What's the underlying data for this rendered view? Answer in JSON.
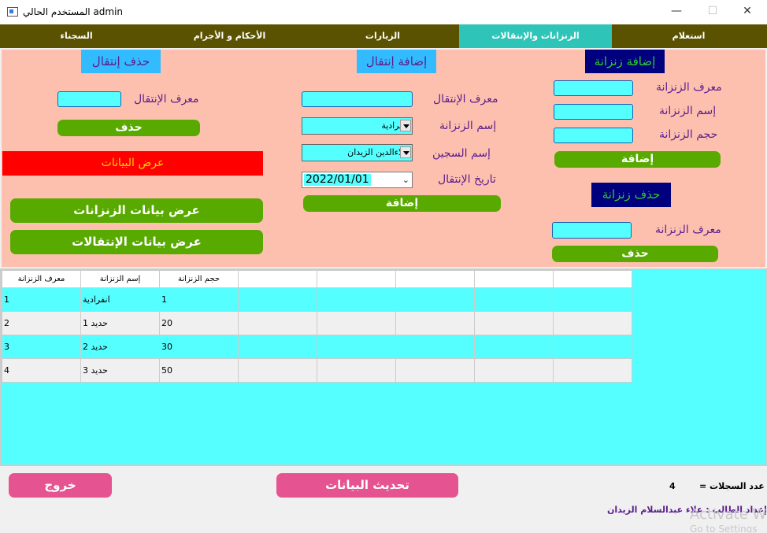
{
  "window": {
    "title": "المستخدم الحالي admin",
    "minimize": "—",
    "maximize": "☐",
    "close": "✕"
  },
  "tabs": {
    "t1": "استعلام",
    "t2": "الزنزانات والإنتقالات",
    "t3": "الزيارات",
    "t4": "الأحكام و الأجرام",
    "t5": "السجناء"
  },
  "cells_section": {
    "add_header": "إضافة زنزانة",
    "cell_id_label": "معرف الزنزانة",
    "cell_name_label": "إسم الزنزانة",
    "cell_size_label": "حجم الزنزانة",
    "add_button": "إضافة",
    "delete_header": "حذف زنزانة",
    "delete_id_label": "معرف الزنزانة",
    "delete_button": "حذف"
  },
  "transfer_section": {
    "add_header": "إضافة إنتقال",
    "transfer_id_label": "معرف الإنتقال",
    "cell_name_label": "إسم الزنزانة",
    "cell_name_selected": "انفرادية",
    "prisoner_name_label": "إسم السجين",
    "prisoner_name_selected": "علاءالدين الزيدان",
    "transfer_date_label": "تاريخ الإنتقال",
    "transfer_date_value": "2022/01/01",
    "add_button": "إضافة"
  },
  "delete_transfer_section": {
    "header": "حذف إنتقال",
    "transfer_id_label": "معرف الإنتقال",
    "delete_button": "حذف",
    "show_data_label": "عرض البيانات",
    "show_cells_button": "عرض بيانات الزنزانات",
    "show_transfers_button": "عرض بيانات الإنتقالات"
  },
  "grid": {
    "headers": [
      "معرف الزنزانة",
      "إسم الزنزانة",
      "حجم الزنزانة",
      "",
      "",
      "",
      "",
      ""
    ],
    "rows": [
      {
        "c1": "1",
        "c2": "انفرادية",
        "c3": "1"
      },
      {
        "c1": "2",
        "c2": "حديد 1",
        "c3": "20"
      },
      {
        "c1": "3",
        "c2": "حديد 2",
        "c3": "30"
      },
      {
        "c1": "4",
        "c2": "حديد 3",
        "c3": "50"
      }
    ]
  },
  "footer": {
    "exit_button": "خروج",
    "refresh_button": "تحديث البيانات",
    "records_label": "عدد السجلات  =",
    "records_count": "4",
    "author": "إعداد الطالب : علاء عبدالسلام الزيدان",
    "activate_line1": "Activate W",
    "activate_line2": "Go to Settings"
  },
  "colors": {
    "tab_bar": "#5a5200",
    "tab_active": "#2ec5b8",
    "panel": "#fec0ae",
    "input": "#55ffff",
    "green_button": "#58aa00",
    "pink_button": "#e55390",
    "show_data_bg": "#ff0000",
    "show_data_text": "#ffd400",
    "navy_header": "#00007f"
  }
}
